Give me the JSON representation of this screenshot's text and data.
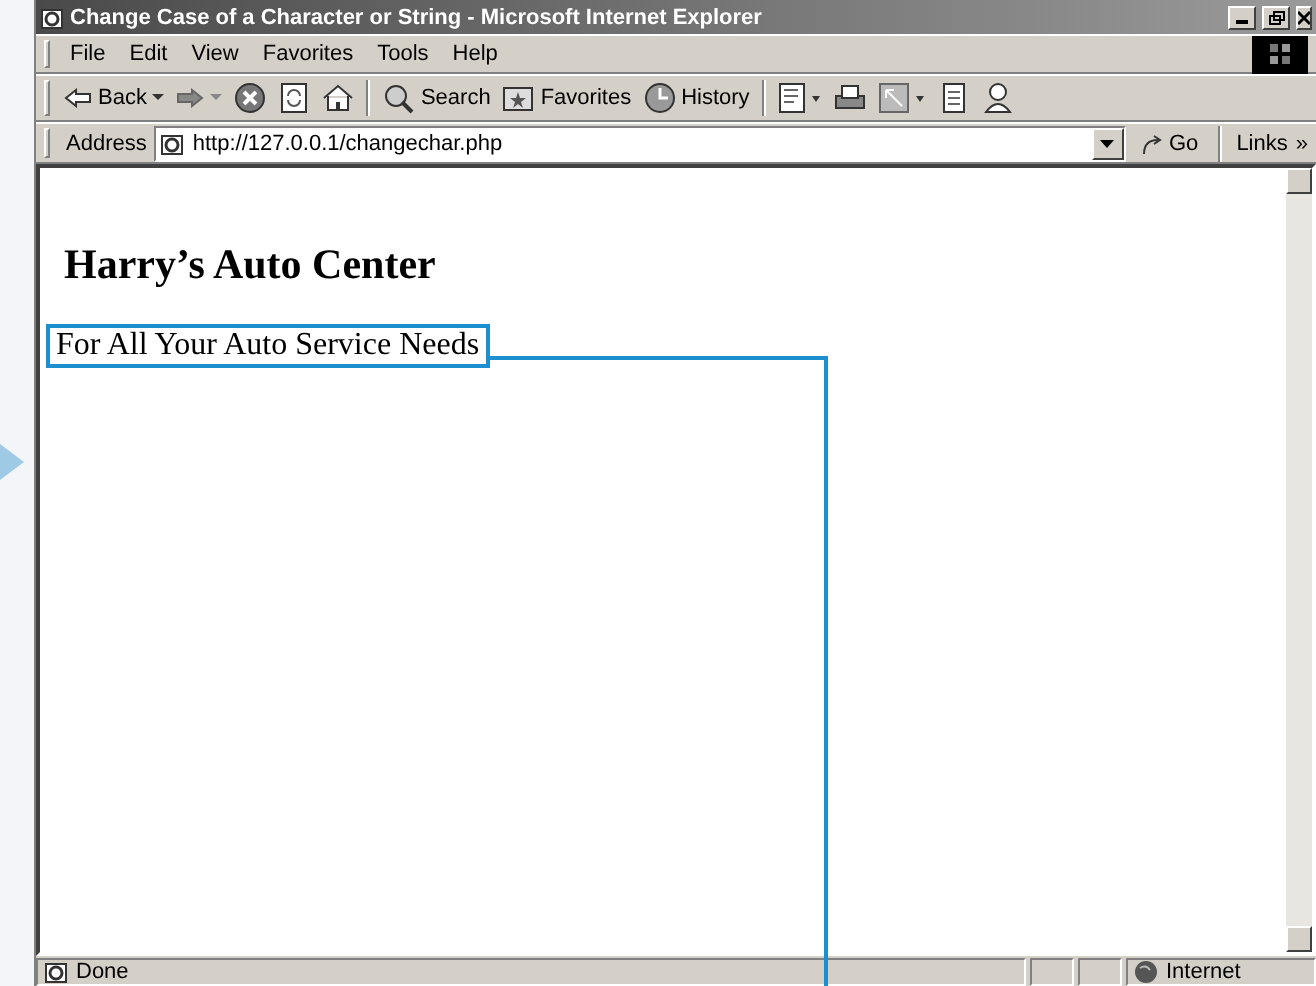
{
  "window": {
    "title": "Change Case of a Character or String - Microsoft Internet Explorer"
  },
  "menu": [
    {
      "label": "File"
    },
    {
      "label": "Edit"
    },
    {
      "label": "View"
    },
    {
      "label": "Favorites"
    },
    {
      "label": "Tools"
    },
    {
      "label": "Help"
    }
  ],
  "toolbar": [
    {
      "kind": "back",
      "label": "Back"
    },
    {
      "kind": "forward"
    },
    {
      "kind": "stop"
    },
    {
      "kind": "refresh"
    },
    {
      "kind": "home"
    },
    {
      "kind": "sep"
    },
    {
      "kind": "search",
      "label": "Search"
    },
    {
      "kind": "favorites",
      "label": "Favorites"
    },
    {
      "kind": "history",
      "label": "History"
    },
    {
      "kind": "sep"
    },
    {
      "kind": "mail"
    },
    {
      "kind": "print"
    },
    {
      "kind": "edit"
    },
    {
      "kind": "discuss"
    },
    {
      "kind": "messenger"
    }
  ],
  "address": {
    "label": "Address",
    "url": "http://127.0.0.1/changechar.php",
    "go": "Go",
    "links": "Links",
    "links_more": "»"
  },
  "page": {
    "heading": "Harry’s Auto Center",
    "tagline": "For All Your Auto Service Needs"
  },
  "status_bar": {
    "text": "Done",
    "zone": "Internet"
  }
}
